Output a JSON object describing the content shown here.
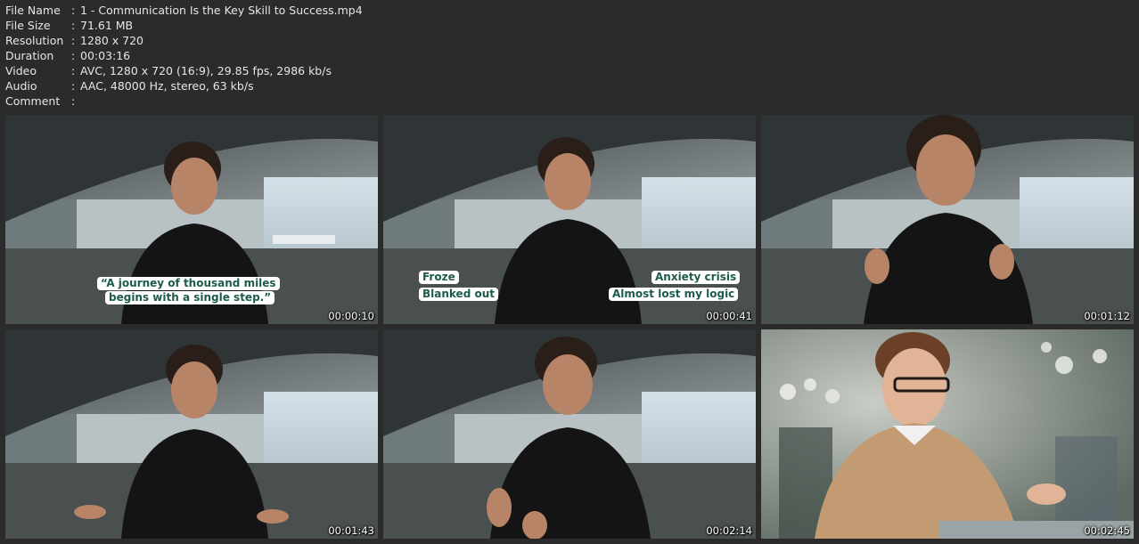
{
  "file_info": [
    {
      "key": "File Name",
      "value": "1 - Communication Is the Key Skill to Success.mp4"
    },
    {
      "key": "File Size",
      "value": "71.61 MB"
    },
    {
      "key": "Resolution",
      "value": "1280 x 720"
    },
    {
      "key": "Duration",
      "value": "00:03:16"
    },
    {
      "key": "Video",
      "value": "AVC, 1280 x 720 (16:9), 29.85 fps, 2986 kb/s"
    },
    {
      "key": "Audio",
      "value": "AAC, 48000 Hz, stereo, 63 kb/s"
    },
    {
      "key": "Comment",
      "value": ""
    }
  ],
  "separator": ":",
  "thumbnails": [
    {
      "timestamp": "00:00:10",
      "captions": [
        "“A journey of thousand miles",
        "begins with a single step.”"
      ]
    },
    {
      "timestamp": "00:00:41",
      "captions": [
        "Froze",
        "Blanked out",
        "Anxiety crisis",
        "Almost lost my logic"
      ]
    },
    {
      "timestamp": "00:01:12",
      "captions": []
    },
    {
      "timestamp": "00:01:43",
      "captions": []
    },
    {
      "timestamp": "00:02:14",
      "captions": []
    },
    {
      "timestamp": "00:02:45",
      "captions": []
    }
  ],
  "colors": {
    "background": "#2b2b2b",
    "text": "#e6e6e6",
    "caption_text": "#1c5b4d",
    "caption_bg": "#ffffff"
  }
}
